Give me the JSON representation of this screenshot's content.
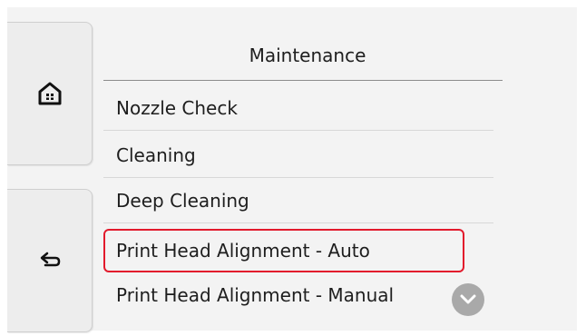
{
  "header": {
    "title": "Maintenance"
  },
  "sidebar": {
    "home_icon": "home-icon",
    "back_icon": "back-arrow-icon"
  },
  "menu": {
    "items": [
      {
        "label": "Nozzle Check"
      },
      {
        "label": "Cleaning"
      },
      {
        "label": "Deep Cleaning"
      },
      {
        "label": "Print Head Alignment - Auto",
        "selected": true
      },
      {
        "label": "Print Head Alignment - Manual"
      }
    ]
  },
  "scroll": {
    "icon": "chevron-down-icon"
  },
  "colors": {
    "highlight": "#e21a2c",
    "background": "#f3f3f3",
    "scroll_button": "#a9a9a9"
  }
}
